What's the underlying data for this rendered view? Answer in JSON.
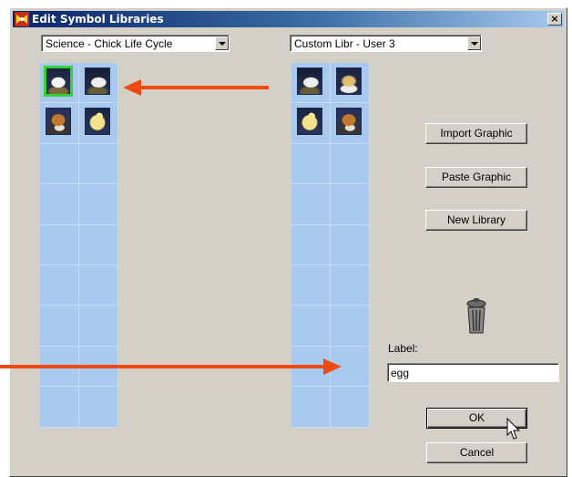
{
  "window": {
    "title": "Edit Symbol Libraries",
    "close_glyph": "×"
  },
  "left_library": {
    "selected": "Science - Chick Life Cycle",
    "symbols": [
      "egg",
      "egg-cracked",
      "chick-wet",
      "chick"
    ],
    "selected_index": 0
  },
  "right_library": {
    "selected": "Custom Libr - User 3",
    "symbols": [
      "egg-cracked",
      "hatching",
      "chick",
      "chick-wet"
    ]
  },
  "buttons": {
    "import": "Import Graphic",
    "paste": "Paste Graphic",
    "new_library": "New Library",
    "ok": "OK",
    "cancel": "Cancel"
  },
  "label_field": {
    "label": "Label:",
    "value": "egg"
  },
  "icons": {
    "title": "app-icon",
    "trash": "trash-can-icon",
    "cursor": "mouse-pointer-icon"
  },
  "colors": {
    "grid": "#a9c9ef",
    "annotation_arrow": "#f04a14",
    "selection": "#34d233",
    "titlebar": "#0a246a"
  }
}
